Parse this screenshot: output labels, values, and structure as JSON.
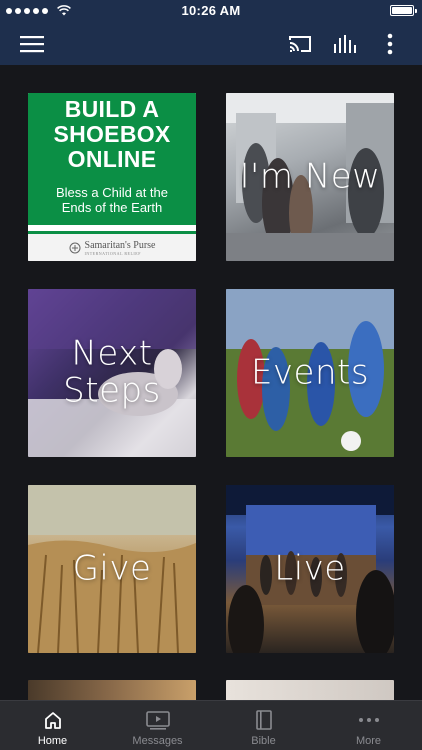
{
  "status_bar": {
    "time": "10:26 AM",
    "signal_icon": "signal-dots-icon",
    "wifi_icon": "wifi-icon",
    "battery_icon": "battery-icon",
    "battery_level": 1.0
  },
  "nav_bar": {
    "menu_icon": "hamburger-menu-icon",
    "cast_icon": "cast-icon",
    "audio_icon": "audio-bars-icon",
    "more_icon": "vertical-ellipsis-icon",
    "background_color": "#1e2f4d"
  },
  "promo": {
    "headline_line1": "BUILD A",
    "headline_line2": "SHOEBOX",
    "headline_line3": "ONLINE",
    "subline1": "Bless a Child at the",
    "subline2": "Ends of the Earth",
    "sponsor": "Samaritan's Purse",
    "sponsor_sub": "INTERNATIONAL RELIEF",
    "green_color": "#0b8f45"
  },
  "tiles": [
    {
      "label": "I'm New"
    },
    {
      "label": "Next Steps"
    },
    {
      "label": "Events"
    },
    {
      "label": "Give"
    },
    {
      "label": "Live"
    }
  ],
  "tab_bar": {
    "items": [
      {
        "label": "Home",
        "icon": "home-icon",
        "active": true
      },
      {
        "label": "Messages",
        "icon": "video-player-icon",
        "active": false
      },
      {
        "label": "Bible",
        "icon": "book-icon",
        "active": false
      },
      {
        "label": "More",
        "icon": "horizontal-ellipsis-icon",
        "active": false
      }
    ]
  }
}
